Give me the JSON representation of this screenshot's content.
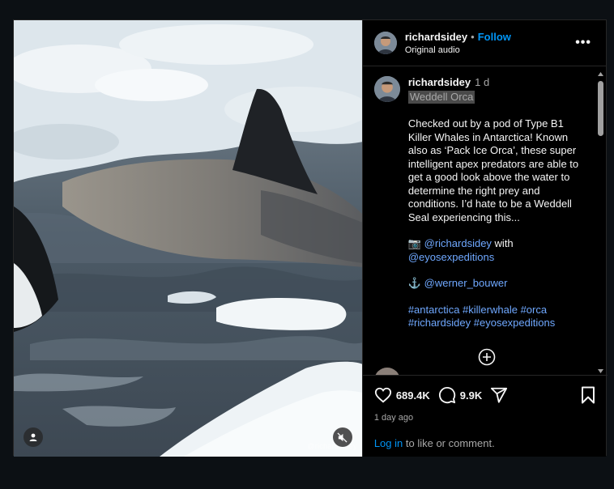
{
  "post": {
    "username": "richardsidey",
    "separator": "•",
    "follow_label": "Follow",
    "audio_label": "Original audio",
    "more_label": "•••"
  },
  "caption": {
    "username": "richardsidey",
    "time": "1 d",
    "location": "Weddell Orca",
    "text": "Checked out by a pod of Type B1 Killer Whales in Antarctica! Known also as ‘Pack Ice Orca’, these super intelligent apex predators are able to get a good look above the water to determine the right prey and conditions. I’d hate to be a Weddell Seal experiencing this...",
    "credit_photo_icon": "📷",
    "credit_photo_handle": "@richardsidey",
    "credit_with": "with",
    "credit_expedition": "@eyosexpeditions",
    "credit_anchor_icon": "⚓",
    "credit_anchor_handle": "@werner_bouwer",
    "hashtags_line1": "#antarctica #killerwhale #orca",
    "hashtags_line2": "#richardsidey #eyosexpeditions"
  },
  "media": {
    "watermark": "@richardsidey"
  },
  "stats": {
    "likes": "689.4K",
    "comments": "9.9K",
    "age": "1 day ago"
  },
  "login": {
    "link": "Log in",
    "text": "to like or comment."
  },
  "colors": {
    "accent": "#0095f6",
    "background": "#0c1014",
    "panel": "#000000",
    "border": "#262626"
  }
}
